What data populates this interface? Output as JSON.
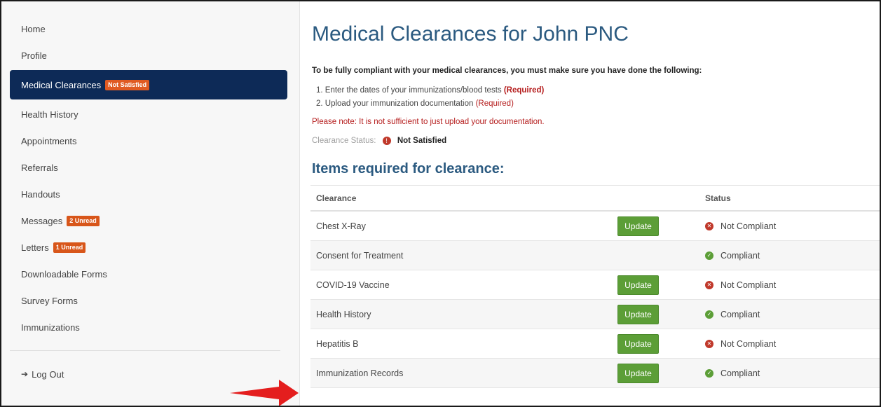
{
  "sidebar": {
    "items": [
      {
        "label": "Home"
      },
      {
        "label": "Profile"
      },
      {
        "label": "Medical Clearances",
        "badge": "Not Satisfied"
      },
      {
        "label": "Health History"
      },
      {
        "label": "Appointments"
      },
      {
        "label": "Referrals"
      },
      {
        "label": "Handouts"
      },
      {
        "label": "Messages",
        "badge": "2 Unread"
      },
      {
        "label": "Letters",
        "badge": "1 Unread"
      },
      {
        "label": "Downloadable Forms"
      },
      {
        "label": "Survey Forms"
      },
      {
        "label": "Immunizations"
      }
    ],
    "logout": "Log Out"
  },
  "main": {
    "title": "Medical Clearances for John PNC",
    "intro": "To be fully compliant with your medical clearances, you must make sure you have done the following:",
    "steps": [
      {
        "text": "1. Enter the dates of your immunizations/blood tests",
        "req": "(Required)"
      },
      {
        "text": "2. Upload your immunization documentation",
        "req": "(Required)"
      }
    ],
    "note": "Please note: It is not sufficient to just upload your documentation.",
    "status_label": "Clearance Status:",
    "status_value": "Not Satisfied",
    "section_title": "Items required for clearance:",
    "table": {
      "headers": [
        "Clearance",
        "",
        "Status"
      ],
      "rows": [
        {
          "name": "Chest X-Ray",
          "action": "Update",
          "status": "Not Compliant",
          "ok": false
        },
        {
          "name": "Consent for Treatment",
          "action": "",
          "status": "Compliant",
          "ok": true
        },
        {
          "name": "COVID-19 Vaccine",
          "action": "Update",
          "status": "Not Compliant",
          "ok": false
        },
        {
          "name": "Health History",
          "action": "Update",
          "status": "Compliant",
          "ok": true
        },
        {
          "name": "Hepatitis B",
          "action": "Update",
          "status": "Not Compliant",
          "ok": false
        },
        {
          "name": "Immunization Records",
          "action": "Update",
          "status": "Compliant",
          "ok": true
        }
      ]
    }
  },
  "colors": {
    "nav_active": "#0d2a57",
    "title": "#2b5a80",
    "button": "#5c9e37",
    "error": "#c0392b"
  }
}
